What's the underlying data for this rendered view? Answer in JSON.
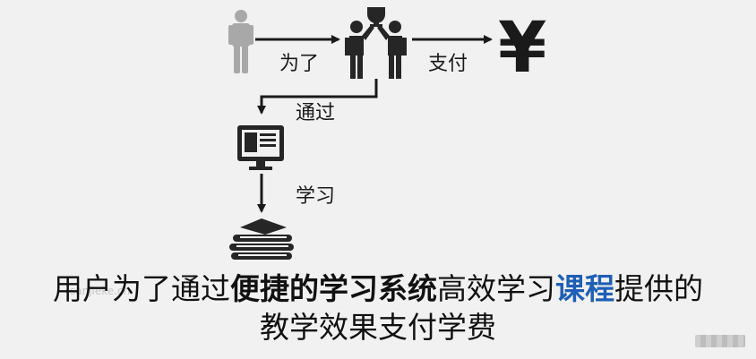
{
  "labels": {
    "for": "为了",
    "pay": "支付",
    "through": "通过",
    "learn": "学习"
  },
  "symbols": {
    "currency": "¥"
  },
  "caption": {
    "line1_part1": "用户为了通过",
    "line1_bold": "便捷的学习系统",
    "line1_part2": "高效学习",
    "line1_blue": "课程",
    "line1_part3": "提供的",
    "line2": "教学效果支付学费"
  },
  "watermark": {
    "sub": "sanjieke.cn"
  },
  "colors": {
    "accent_blue": "#1f5fb5",
    "user_gray": "#a8a8a8",
    "icon_dark": "#262626"
  },
  "icons": [
    "user-icon",
    "teamwork-trophy-icon",
    "yen-icon",
    "computer-monitor-icon",
    "book-stack-icon"
  ]
}
